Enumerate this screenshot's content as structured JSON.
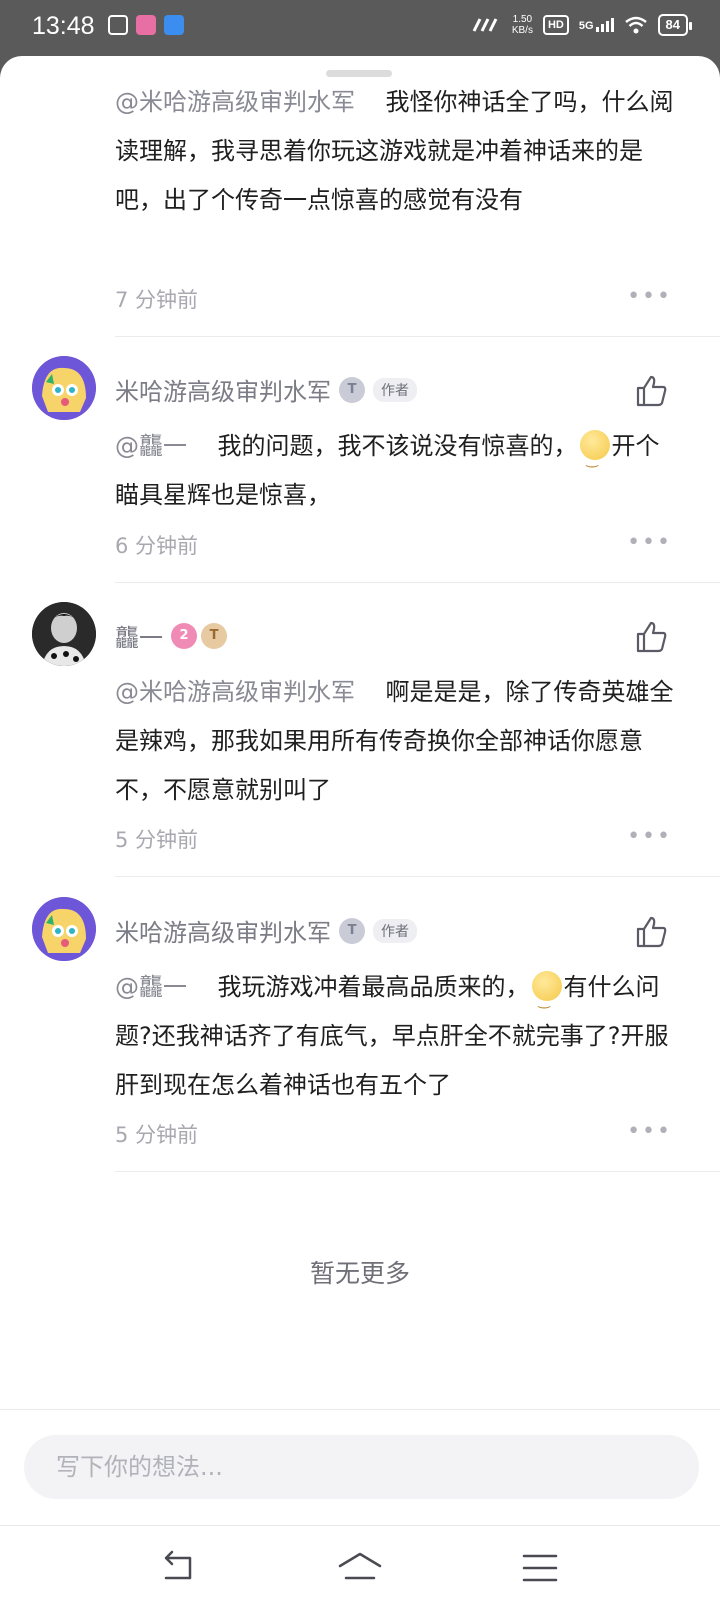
{
  "status_bar": {
    "time": "13:48",
    "network_speed_value": "1.50",
    "network_speed_unit": "KB/s",
    "hd": "HD",
    "signal": "5G",
    "battery": "84"
  },
  "comments": [
    {
      "mention": "@米哈游高级审判水军",
      "text": "我怪你神话全了吗，什么阅读理解，我寻思着你玩这游戏就是冲着神话来的是吧，出了个传奇一点惊喜的感觉有没有",
      "time": "7 分钟前"
    },
    {
      "username": "米哈游高级审判水军",
      "author_tag": "作者",
      "mention": "@龘一",
      "text_before": "我的问题，我不该说没有惊喜的，",
      "text_after": "开个瞄具星辉也是惊喜，",
      "time": "6 分钟前"
    },
    {
      "username": "龘一",
      "badge_number": "2",
      "mention": "@米哈游高级审判水军",
      "text": "啊是是是，除了传奇英雄全是辣鸡，那我如果用所有传奇换你全部神话你愿意不，不愿意就别叫了",
      "time": "5 分钟前"
    },
    {
      "username": "米哈游高级审判水军",
      "author_tag": "作者",
      "mention": "@龘一",
      "text_before": "我玩游戏冲着最高品质来的，",
      "text_after": "有什么问题?还我神话齐了有底气，早点肝全不就完事了?开服肝到现在怎么着神话也有五个了",
      "time": "5 分钟前"
    }
  ],
  "end_text": "暂无更多",
  "input": {
    "placeholder": "写下你的想法..."
  },
  "more_glyph": "•••"
}
